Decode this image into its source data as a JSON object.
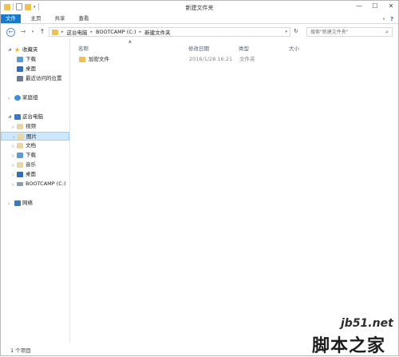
{
  "window": {
    "title": "新建文件夹",
    "minimize": "—",
    "maximize": "☐",
    "close": "✕"
  },
  "ribbon": {
    "tabs": [
      {
        "label": "文件"
      },
      {
        "label": "主页"
      },
      {
        "label": "共享"
      },
      {
        "label": "查看"
      }
    ],
    "help_label": "?"
  },
  "toolbar": {
    "back": "←",
    "forward": "→",
    "recent": "▾",
    "up": "↑",
    "refresh": "↻"
  },
  "address": {
    "crumbs": [
      "这台电脑",
      "BOOTCAMP (C:)",
      "新建文件夹"
    ],
    "separator": "▸"
  },
  "search": {
    "placeholder": "搜索\"新建文件夹\"",
    "icon": "search-icon"
  },
  "navpane": {
    "favorites": {
      "label": "收藏夹",
      "items": [
        "下载",
        "桌面",
        "最近访问的位置"
      ]
    },
    "homegroup": {
      "label": "家庭组"
    },
    "thispc": {
      "label": "这台电脑",
      "items": [
        "视频",
        "图片",
        "文档",
        "下载",
        "音乐",
        "桌面",
        "BOOTCAMP (C:)"
      ]
    },
    "network": {
      "label": "网络"
    },
    "selected": "图片"
  },
  "columns": [
    {
      "label": "名称"
    },
    {
      "label": "修改日期"
    },
    {
      "label": "类型"
    },
    {
      "label": "大小"
    }
  ],
  "files": [
    {
      "name": "加密文件",
      "date": "2016/1/28 16:21",
      "type": "文件夹",
      "size": ""
    }
  ],
  "status": {
    "count": "1 个项目"
  },
  "watermark": {
    "line1": "jb51.net",
    "line2": "脚本之家"
  },
  "colors": {
    "accent": "#1979ca",
    "selection": "#cce8ff",
    "folder": "#f0c24d"
  }
}
